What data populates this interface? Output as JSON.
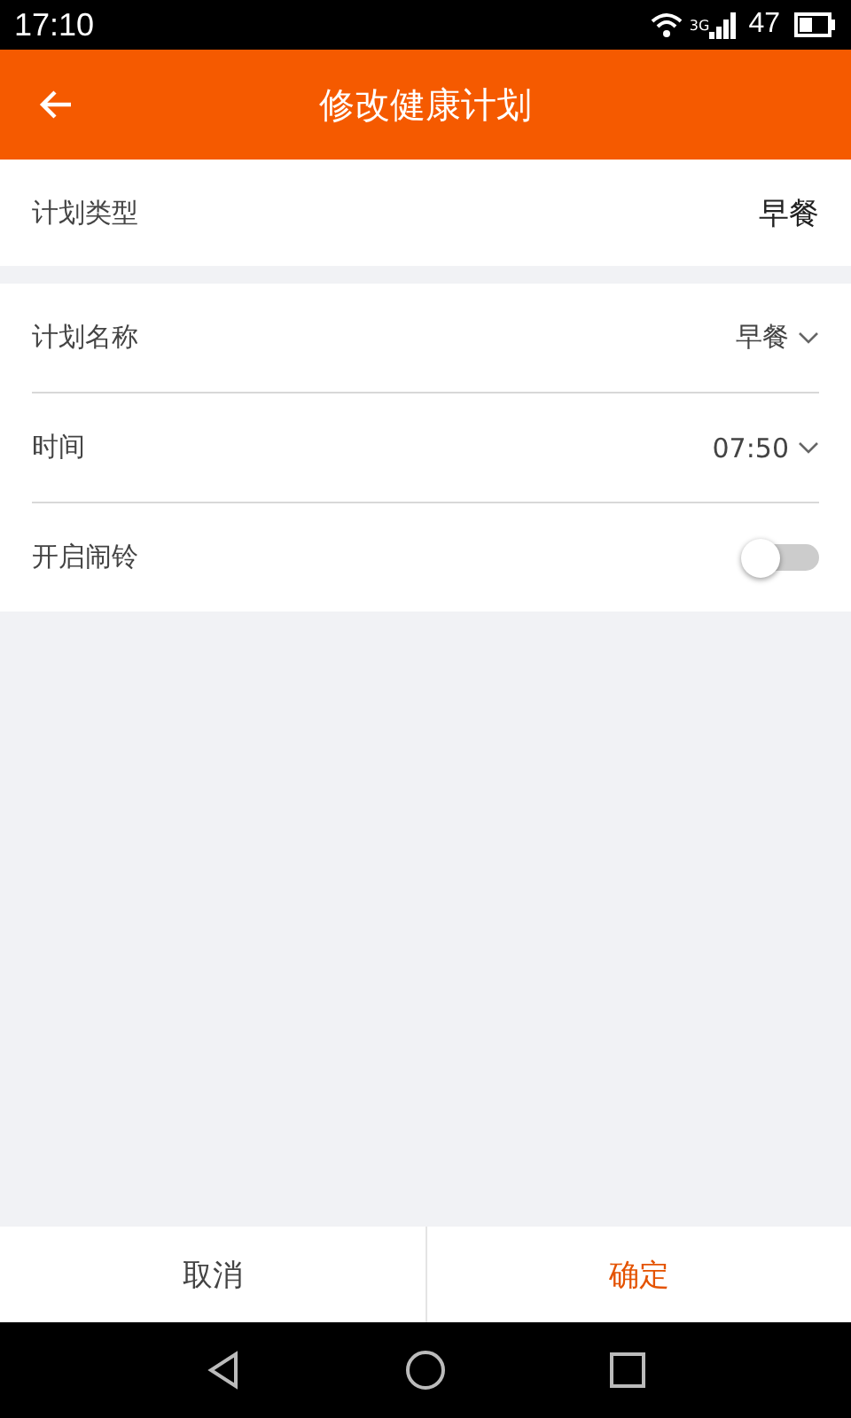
{
  "status_bar": {
    "time": "17:10",
    "network": "3G",
    "battery": "47"
  },
  "header": {
    "title": "修改健康计划"
  },
  "type_row": {
    "label": "计划类型",
    "value": "早餐"
  },
  "rows": [
    {
      "kind": "select",
      "label": "计划名称",
      "value": "早餐"
    },
    {
      "kind": "select",
      "label": "时间",
      "value": "07:50"
    },
    {
      "kind": "toggle",
      "label": "开启闹铃",
      "on": false
    }
  ],
  "buttons": [
    {
      "label": "取消",
      "primary": false
    },
    {
      "label": "确定",
      "primary": true
    }
  ]
}
